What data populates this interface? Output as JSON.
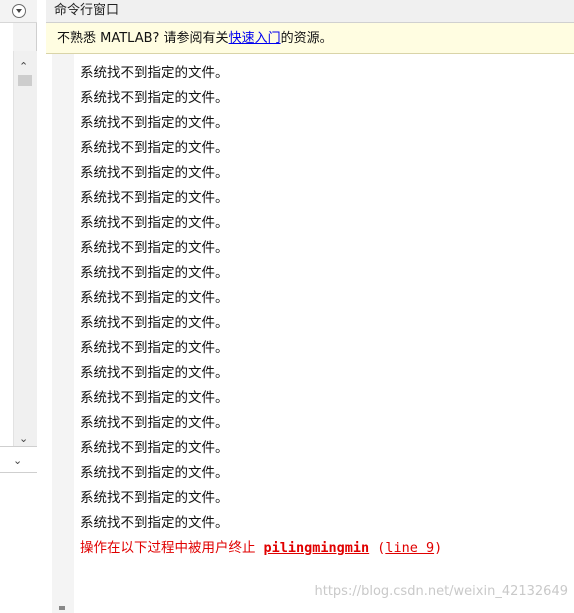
{
  "window": {
    "title": "命令行窗口"
  },
  "notice": {
    "prefix": "不熟悉 MATLAB? 请参阅有关",
    "link": "快速入门",
    "suffix": "的资源。"
  },
  "output": {
    "lines": [
      "系统找不到指定的文件。",
      "系统找不到指定的文件。",
      "系统找不到指定的文件。",
      "系统找不到指定的文件。",
      "系统找不到指定的文件。",
      "系统找不到指定的文件。",
      "系统找不到指定的文件。",
      "系统找不到指定的文件。",
      "系统找不到指定的文件。",
      "系统找不到指定的文件。",
      "系统找不到指定的文件。",
      "系统找不到指定的文件。",
      "系统找不到指定的文件。",
      "系统找不到指定的文件。",
      "系统找不到指定的文件。",
      "系统找不到指定的文件。",
      "系统找不到指定的文件。",
      "系统找不到指定的文件。",
      "系统找不到指定的文件。"
    ],
    "error": {
      "message": "操作在以下过程中被用户终止",
      "function": "pilingmingmin",
      "open_paren": "(",
      "line_link": "line 9",
      "close_paren": ")"
    }
  },
  "watermark": "https://blog.csdn.net/weixin_42132649",
  "icons": {
    "collapse": "collapse-circle-icon",
    "scroll_up": "chevron-up-icon",
    "scroll_down": "chevron-down-icon",
    "dropdown": "chevron-down-icon"
  },
  "colors": {
    "notice_bg": "#fffde1",
    "link": "#0000ee",
    "error": "#e00000"
  }
}
